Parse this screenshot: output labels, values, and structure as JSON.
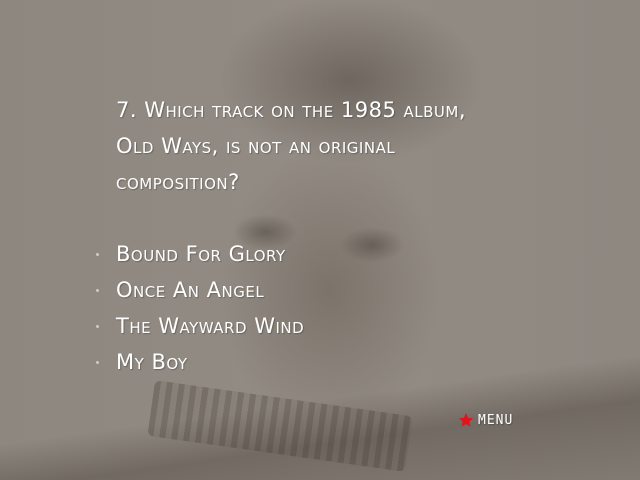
{
  "quiz": {
    "question_lines": [
      "7. Which track on the 1985 album,",
      "Old Ways, is not an original",
      "composition?"
    ],
    "answers": [
      "Bound For Glory",
      "Once An Angel",
      "The Wayward Wind",
      "My Boy"
    ]
  },
  "menu": {
    "label": "MENU",
    "icon": "star-icon",
    "icon_color": "#e0141c"
  },
  "colors": {
    "text": "#ffffff",
    "background": "#8f8982"
  }
}
